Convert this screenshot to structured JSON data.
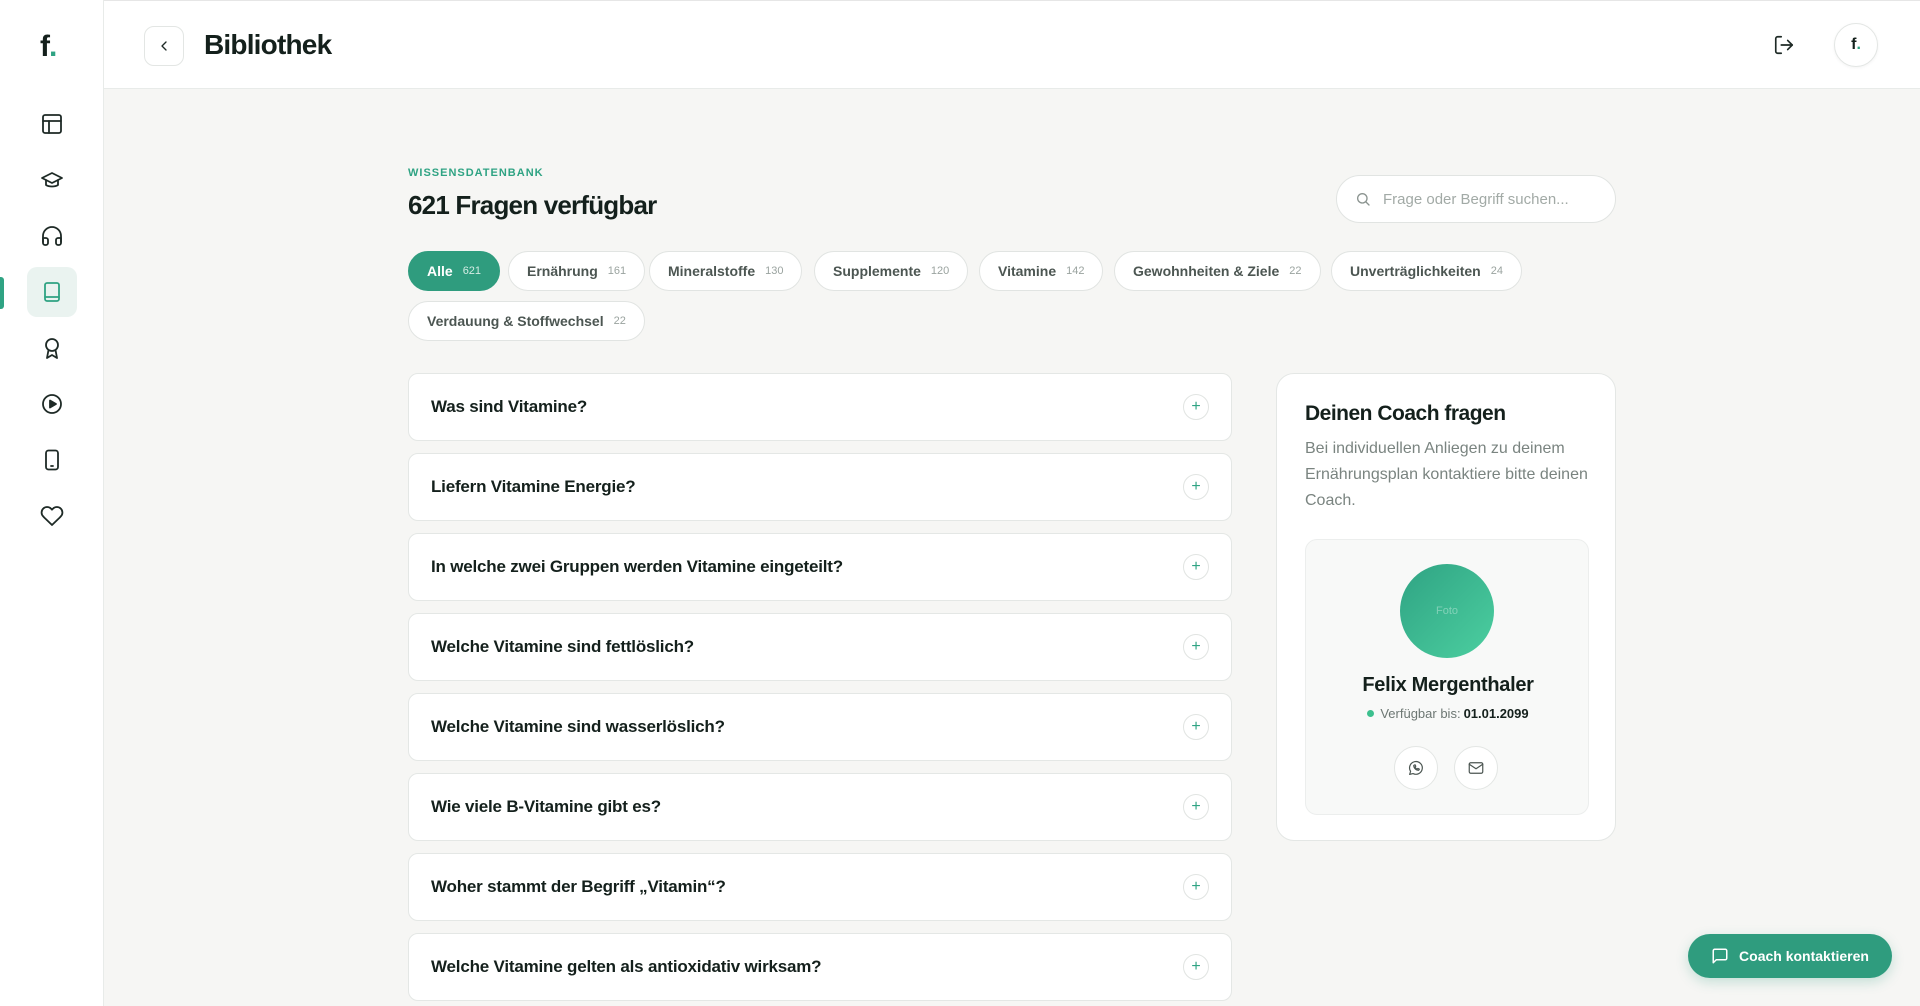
{
  "brand": {
    "logo_letter": "f",
    "logo_dot": ".",
    "accent": "#2fa383"
  },
  "topbar": {
    "title": "Bibliothek",
    "avatar_letter": "f",
    "avatar_dot": "."
  },
  "sidebar": {
    "items": [
      {
        "icon": "layout-icon",
        "active": false
      },
      {
        "icon": "graduation-cap-icon",
        "active": false
      },
      {
        "icon": "headphones-icon",
        "active": false
      },
      {
        "icon": "book-icon",
        "active": true
      },
      {
        "icon": "award-icon",
        "active": false
      },
      {
        "icon": "play-circle-icon",
        "active": false
      },
      {
        "icon": "smartphone-icon",
        "active": false
      },
      {
        "icon": "heart-icon",
        "active": false
      }
    ]
  },
  "library": {
    "eyebrow": "WISSENSDATENBANK",
    "heading": "621 Fragen verfügbar",
    "search_placeholder": "Frage oder Begriff suchen...",
    "filters": [
      {
        "label": "Alle",
        "count": "621",
        "active": true
      },
      {
        "label": "Ernährung",
        "count": "161",
        "active": false
      },
      {
        "label": "Mineralstoffe",
        "count": "130",
        "active": false
      },
      {
        "label": "Supplemente",
        "count": "120",
        "active": false
      },
      {
        "label": "Vitamine",
        "count": "142",
        "active": false
      },
      {
        "label": "Gewohnheiten & Ziele",
        "count": "22",
        "active": false
      },
      {
        "label": "Unverträglichkeiten",
        "count": "24",
        "active": false
      },
      {
        "label": "Verdauung & Stoffwechsel",
        "count": "22",
        "active": false
      }
    ],
    "questions": [
      "Was sind Vitamine?",
      "Liefern Vitamine Energie?",
      "In welche zwei Gruppen werden Vitamine eingeteilt?",
      "Welche Vitamine sind fettlöslich?",
      "Welche Vitamine sind wasserlöslich?",
      "Wie viele B-Vitamine gibt es?",
      "Woher stammt der Begriff „Vitamin“?",
      "Welche Vitamine gelten als antioxidativ wirksam?"
    ],
    "toggle_symbol": "+"
  },
  "coach": {
    "title": "Deinen Coach fragen",
    "text": "Bei individuellen Anliegen zu deinem Ernährungsplan kontaktiere bitte deinen Coach.",
    "photo_label": "Foto",
    "name": "Felix Mergenthaler",
    "available_label": "Verfügbar bis:",
    "available_date": "01.01.2099"
  },
  "fab": {
    "label": "Coach kontaktieren"
  }
}
